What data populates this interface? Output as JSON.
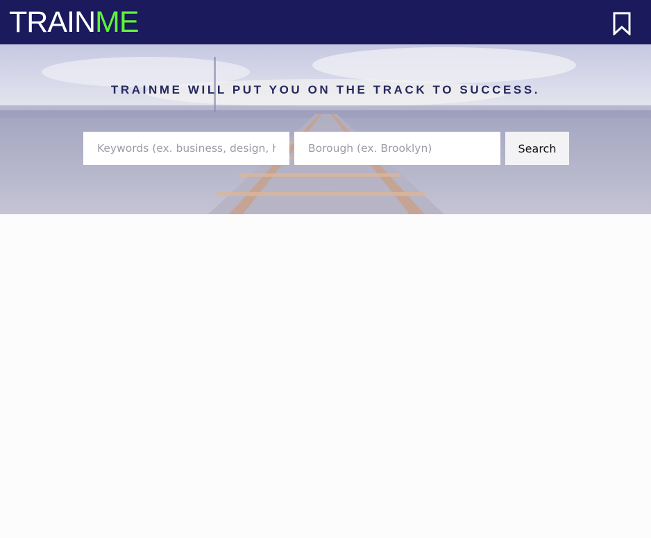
{
  "header": {
    "logo_part1": "TRAIN",
    "logo_part2": "ME",
    "bookmark_icon": "bookmark-icon"
  },
  "hero": {
    "tagline": "TRAINME WILL PUT YOU ON THE TRACK TO SUCCESS.",
    "keywords_placeholder": "Keywords (ex. business, design, health)",
    "borough_placeholder": "Borough (ex. Brooklyn)",
    "search_label": "Search"
  },
  "colors": {
    "navbar": "#1a1a5c",
    "logo_accent": "#5ff23a",
    "tagline": "#25285e"
  }
}
